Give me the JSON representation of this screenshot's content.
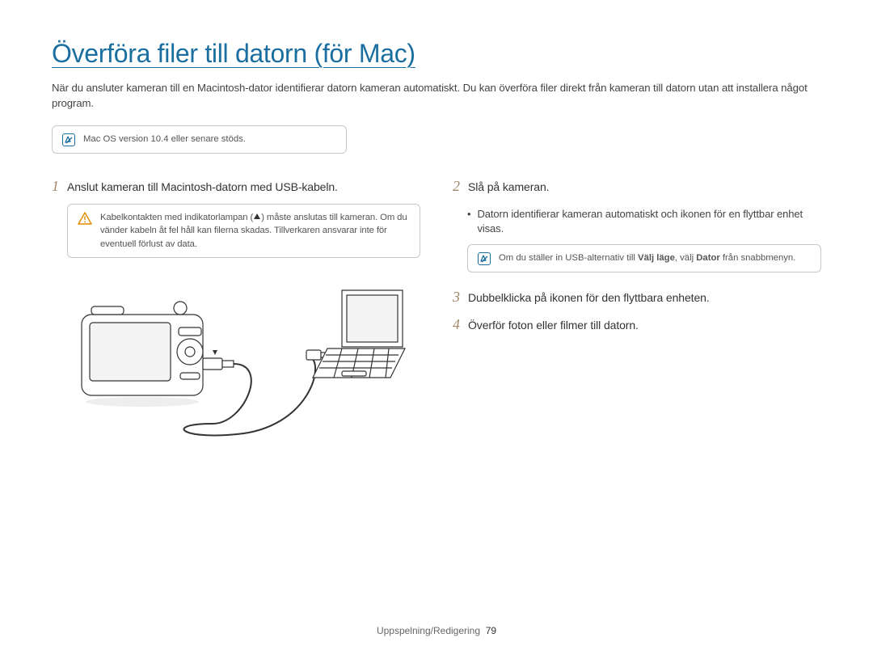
{
  "title": "Överföra filer till datorn (för Mac)",
  "intro": "När du ansluter kameran till en Macintosh-dator identifierar datorn kameran automatiskt. Du kan överföra filer direkt från kameran till datorn utan att installera något program.",
  "top_note": "Mac OS version 10.4 eller senare stöds.",
  "steps": {
    "s1": {
      "num": "1",
      "text": "Anslut kameran till Macintosh-datorn med USB-kabeln.",
      "warn_pre": "Kabelkontakten med indikatorlampan (",
      "warn_post": ") måste anslutas till kameran. Om du vänder kabeln åt fel håll kan filerna skadas. Tillverkaren ansvarar inte för eventuell förlust av data."
    },
    "s2": {
      "num": "2",
      "text": "Slå på kameran.",
      "bullet": "Datorn identifierar kameran automatiskt och ikonen för en flyttbar enhet visas.",
      "note_pre": "Om du ställer in USB-alternativ till ",
      "note_b1": "Välj läge",
      "note_mid": ", välj ",
      "note_b2": "Dator",
      "note_post": " från snabbmenyn."
    },
    "s3": {
      "num": "3",
      "text": "Dubbelklicka på ikonen för den flyttbara enheten."
    },
    "s4": {
      "num": "4",
      "text": "Överför foton eller filmer till datorn."
    }
  },
  "footer": {
    "section": "Uppspelning/Redigering",
    "page": "79"
  }
}
